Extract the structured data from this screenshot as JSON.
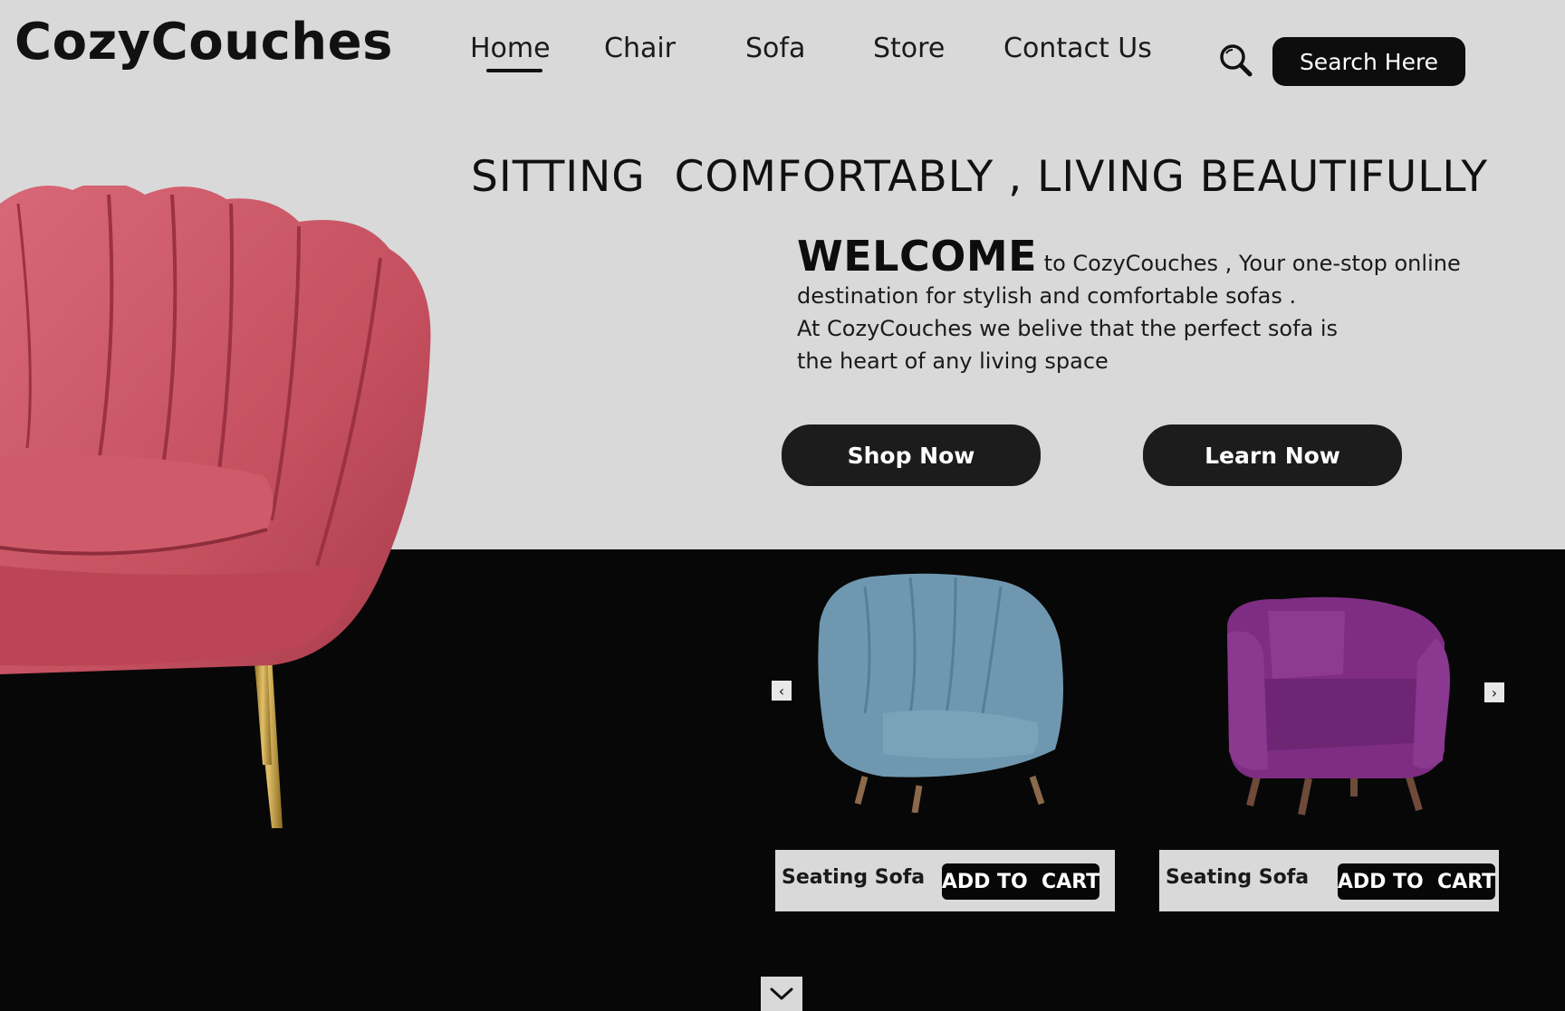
{
  "brand": {
    "logo": "CozyCouches"
  },
  "nav": {
    "items": [
      {
        "label": "Home",
        "active": true
      },
      {
        "label": "Chair"
      },
      {
        "label": "Sofa"
      },
      {
        "label": "Store"
      },
      {
        "label": "Contact Us"
      }
    ],
    "search_icon": "search-icon",
    "search_button": "Search Here"
  },
  "hero": {
    "headline": "SITTING  COMFORTABLY , LIVING BEAUTIFULLY",
    "welcome_big": "WELCOME",
    "welcome_line1": " to CozyCouches , Your one-stop online",
    "welcome_line2": "destination for stylish and comfortable sofas .",
    "welcome_line3": "At CozyCouches we belive that the perfect sofa is",
    "welcome_line4": "the heart of any living space",
    "shop_button": "Shop Now",
    "learn_button": "Learn Now"
  },
  "products": [
    {
      "title": "Seating Sofa",
      "button": "ADD TO  CART",
      "color": "#6f98b0"
    },
    {
      "title": "Seating Sofa",
      "button": "ADD TO  CART",
      "color": "#7e2d83"
    }
  ],
  "carousel": {
    "prev_icon": "chevron-left-icon",
    "next_icon": "chevron-right-icon",
    "down_icon": "chevron-down-icon"
  },
  "colors": {
    "background": "#d9d9d9",
    "dark": "#070707",
    "accent_chair": "#c5505f"
  }
}
